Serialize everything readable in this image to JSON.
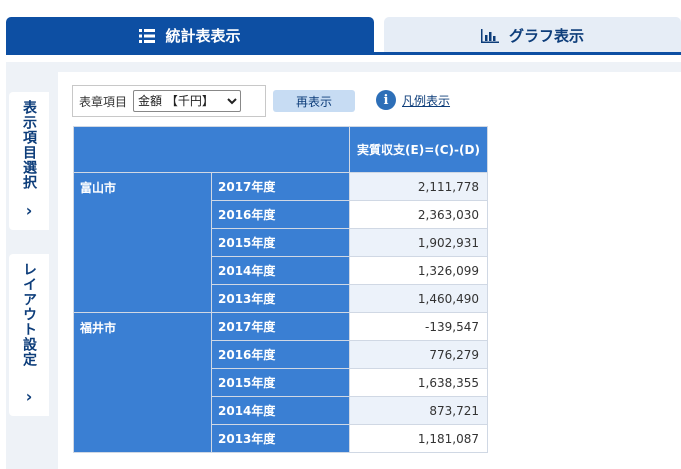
{
  "tabs": {
    "stats": {
      "label": "統計表表示",
      "icon": "list-icon"
    },
    "graph": {
      "label": "グラフ表示",
      "icon": "bar-chart-icon"
    }
  },
  "side": {
    "items_label": "表示項目選択",
    "layout_label": "レイアウト設定",
    "chevron": "›"
  },
  "toolbar": {
    "table_item_label": "表章項目",
    "select_value": "金額 【千円】",
    "select_options": [
      "金額 【千円】"
    ],
    "redisplay_label": "再表示",
    "legend_label": "凡例表示",
    "info_glyph": "i"
  },
  "table": {
    "column_header": "実質収支(E)=(C)-(D)",
    "groups": [
      {
        "city": "富山市",
        "rows": [
          {
            "year": "2017年度",
            "value": "2,111,778"
          },
          {
            "year": "2016年度",
            "value": "2,363,030"
          },
          {
            "year": "2015年度",
            "value": "1,902,931"
          },
          {
            "year": "2014年度",
            "value": "1,326,099"
          },
          {
            "year": "2013年度",
            "value": "1,460,490"
          }
        ]
      },
      {
        "city": "福井市",
        "rows": [
          {
            "year": "2017年度",
            "value": "-139,547"
          },
          {
            "year": "2016年度",
            "value": "776,279"
          },
          {
            "year": "2015年度",
            "value": "1,638,355"
          },
          {
            "year": "2014年度",
            "value": "873,721"
          },
          {
            "year": "2013年度",
            "value": "1,181,087"
          }
        ]
      }
    ]
  },
  "colors": {
    "primary": "#0d4fa3",
    "header_blue": "#3a7fd3",
    "stripe": "#ecf2fa"
  }
}
